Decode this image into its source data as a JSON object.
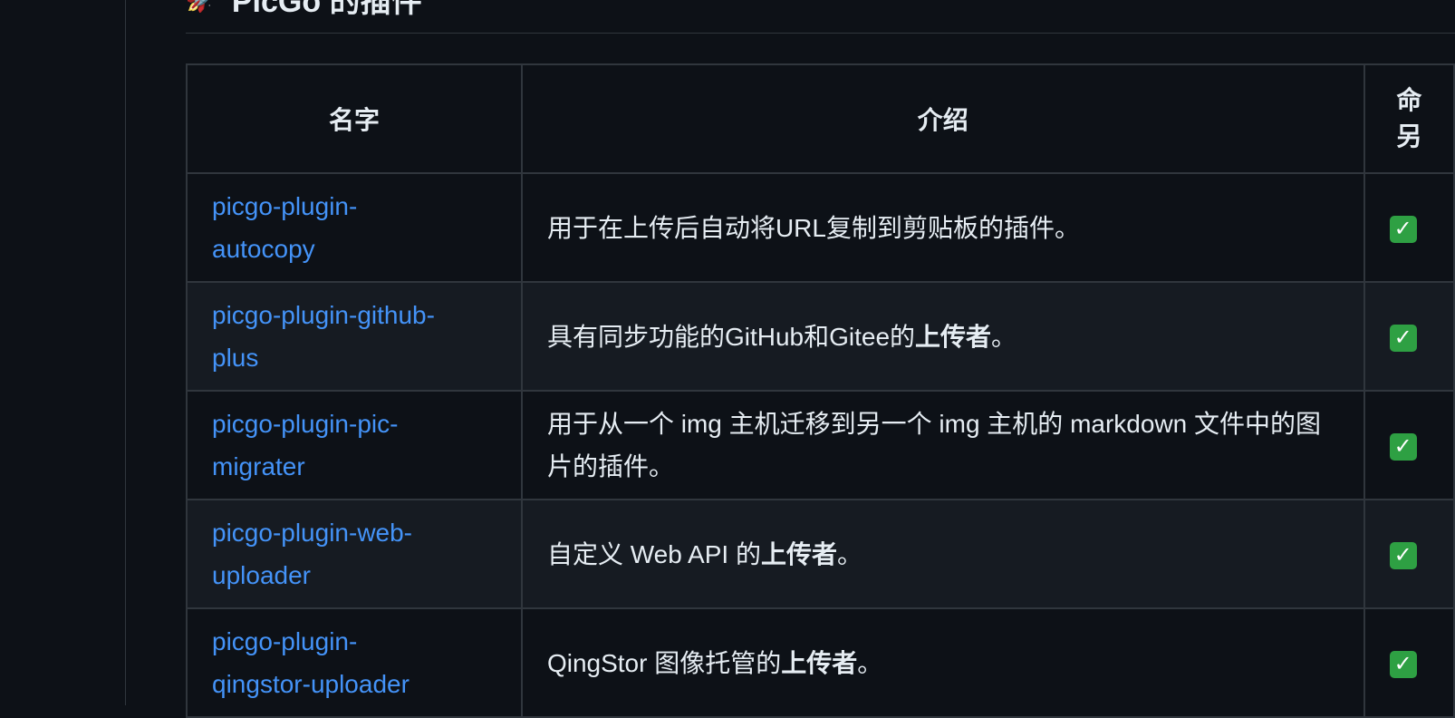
{
  "heading": {
    "icon": "rocket-icon",
    "text": "PicGo 的插件"
  },
  "table": {
    "headers": {
      "name": "名字",
      "description": "介绍",
      "cli_line1": "命",
      "cli_line2": "另"
    },
    "rows": [
      {
        "name_line1": "picgo-plugin-",
        "name_line2": "autocopy",
        "desc": "用于在上传后自动将URL复制到剪贴板的插件。",
        "desc_strong": "",
        "desc_tail": "",
        "check": "✓"
      },
      {
        "name_line1": "picgo-plugin-github-",
        "name_line2": "plus",
        "desc": "具有同步功能的GitHub和Gitee的",
        "desc_strong": "上传者",
        "desc_tail": "。",
        "check": "✓"
      },
      {
        "name_line1": "picgo-plugin-pic-",
        "name_line2": "migrater",
        "desc": "用于从一个 img 主机迁移到另一个 img 主机的 markdown 文件中的图片的插件。",
        "desc_strong": "",
        "desc_tail": "",
        "check": "✓"
      },
      {
        "name_line1": "picgo-plugin-web-",
        "name_line2": "uploader",
        "desc": "自定义 Web API 的",
        "desc_strong": "上传者",
        "desc_tail": "。",
        "check": "✓"
      },
      {
        "name_line1": "picgo-plugin-",
        "name_line2": "qingstor-uploader",
        "desc": "QingStor 图像托管的",
        "desc_strong": "上传者",
        "desc_tail": "。",
        "check": "✓"
      }
    ]
  },
  "colors": {
    "background": "#0d1117",
    "row_alt": "#161b22",
    "border": "#30363d",
    "link": "#4493f8",
    "check": "#2ea043"
  }
}
